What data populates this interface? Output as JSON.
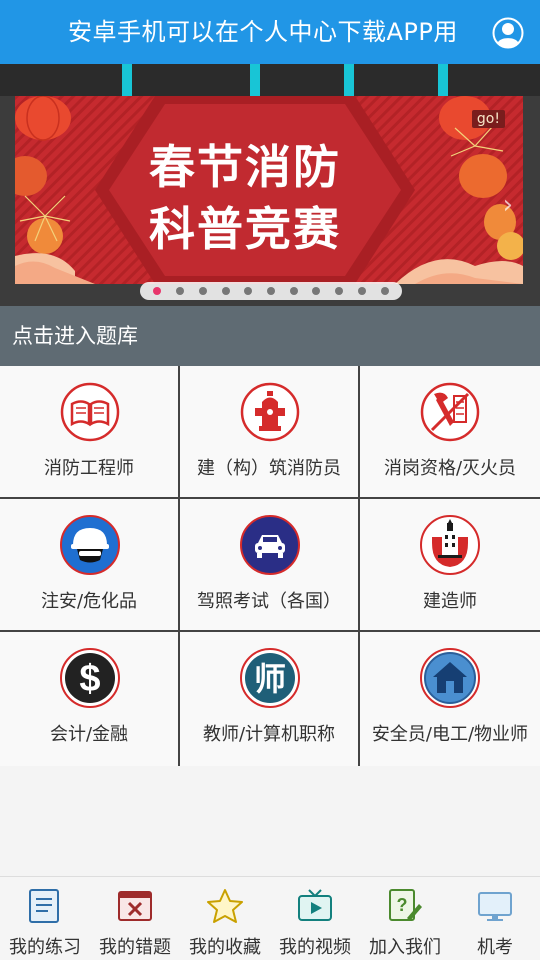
{
  "header": {
    "title": "安卓手机可以在个人中心下载APP用",
    "background": "#2196e6"
  },
  "banner": {
    "headline_line1": "春节消防",
    "headline_line2": "科普竞赛",
    "badge": "go!",
    "slide_count": 11,
    "active_slide": 1
  },
  "section": {
    "title": "点击进入题库"
  },
  "categories": [
    {
      "label": "消防工程师",
      "icon": "open-book-icon"
    },
    {
      "label": "建（构）筑消防员",
      "icon": "fire-hydrant-icon"
    },
    {
      "label": "消岗资格/灭火员",
      "icon": "no-fire-axe-icon"
    },
    {
      "label": "注安/危化品",
      "icon": "helmet-icon"
    },
    {
      "label": "驾照考试（各国）",
      "icon": "car-icon"
    },
    {
      "label": "建造师",
      "icon": "building-icon"
    },
    {
      "label": "会计/金融",
      "icon": "dollar-icon"
    },
    {
      "label": "教师/计算机职称",
      "icon": "teacher-icon"
    },
    {
      "label": "安全员/电工/物业师",
      "icon": "house-icon"
    }
  ],
  "bottom_nav": [
    {
      "label": "我的练习",
      "icon": "document-icon"
    },
    {
      "label": "我的错题",
      "icon": "wrong-answers-icon"
    },
    {
      "label": "我的收藏",
      "icon": "star-icon"
    },
    {
      "label": "我的视频",
      "icon": "tv-icon"
    },
    {
      "label": "加入我们",
      "icon": "question-edit-icon"
    },
    {
      "label": "机考",
      "icon": "monitor-icon"
    }
  ]
}
